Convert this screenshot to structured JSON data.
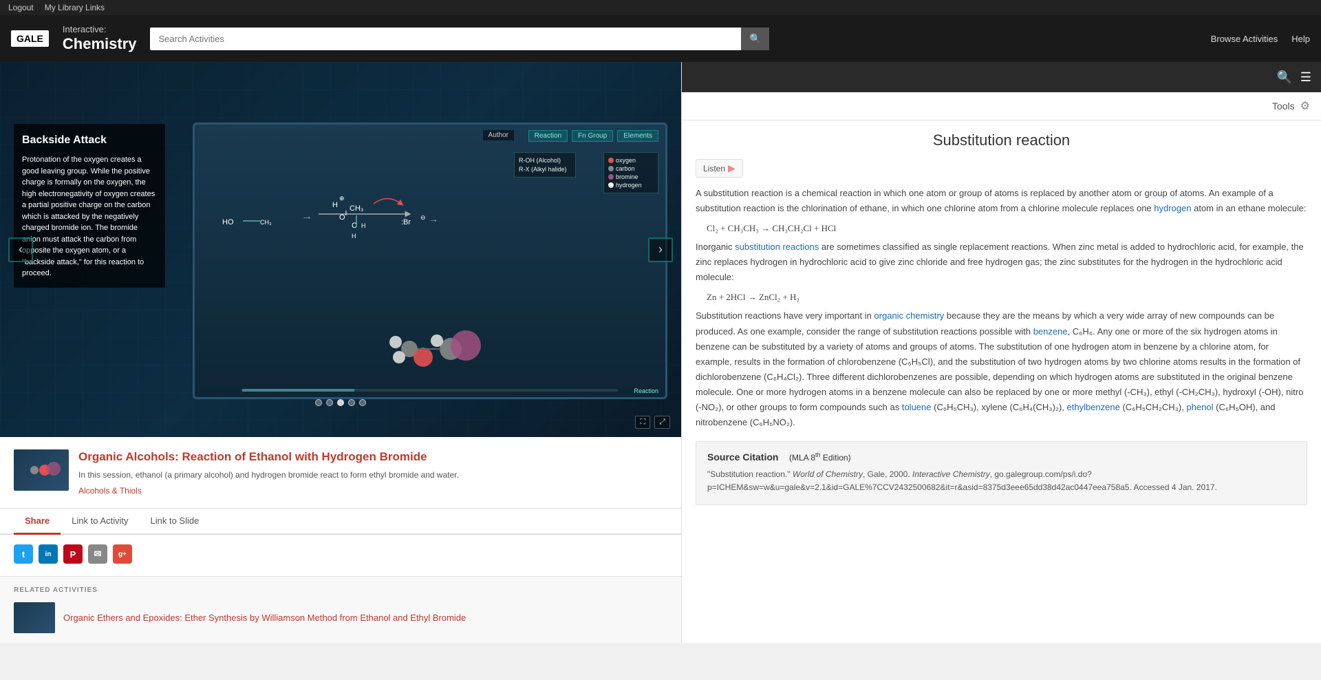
{
  "topnav": {
    "logout": "Logout",
    "library_links": "My Library Links"
  },
  "header": {
    "logo": "GALE",
    "subtitle": "Interactive:",
    "title": "Chemistry",
    "search_placeholder": "Search Activities",
    "browse": "Browse Activities",
    "help": "Help"
  },
  "viewer": {
    "title": "Backside Attack",
    "description": "Protonation of the oxygen creates a good leaving group. While the positive charge is formally on the oxygen, the high electronegativity of oxygen creates a partial positive charge on the carbon which is attacked by the negatively charged bromide ion. The bromide anion must attack the carbon from opposite the oxygen atom, or a \"backside attack,\" for this reaction to proceed.",
    "author_badge": "Author",
    "panels": [
      "Reaction",
      "Fn Group",
      "Elements"
    ],
    "legend": [
      {
        "label": "oxygen",
        "color": "#e05050"
      },
      {
        "label": "carbon",
        "color": "#888"
      },
      {
        "label": "bromine",
        "color": "#a05080"
      },
      {
        "label": "hydrogen",
        "color": "#eee"
      }
    ],
    "fn_group_labels": [
      "R-OH (Alcohol)",
      "R-X (Alkyl halide)"
    ],
    "reaction_label": "Reaction",
    "dots_count": 5,
    "active_dot": 2
  },
  "activity": {
    "title": "Organic Alcohols: Reaction of Ethanol with Hydrogen Bromide",
    "description": "In this session, ethanol (a primary alcohol) and hydrogen bromide react to form ethyl bromide and water.",
    "category": "Alcohols & Thiols"
  },
  "tabs": [
    {
      "label": "Share",
      "active": true
    },
    {
      "label": "Link to Activity",
      "active": false
    },
    {
      "label": "Link to Slide",
      "active": false
    }
  ],
  "social": [
    {
      "name": "Twitter",
      "class": "twitter",
      "symbol": "t"
    },
    {
      "name": "LinkedIn",
      "class": "linkedin",
      "symbol": "in"
    },
    {
      "name": "Pinterest",
      "class": "pinterest",
      "symbol": "P"
    },
    {
      "name": "Email",
      "class": "email",
      "symbol": "✉"
    },
    {
      "name": "Google",
      "class": "google",
      "symbol": "g+"
    }
  ],
  "related": {
    "label": "RELATED ACTIVITIES",
    "item_title": "Organic Ethers and Epoxides: Ether Synthesis by Williamson Method from Ethanol and Ethyl Bromide"
  },
  "article": {
    "title": "Substitution reaction",
    "listen_label": "Listen",
    "body_1": "A substitution reaction is a chemical reaction in which one atom or group of atoms is replaced by another atom or group of atoms. An example of a substitution reaction is the chlorination of ethane, in which one chlorine atom from a chlorine molecule replaces one hydrogen atom in an ethane molecule:",
    "eq1": "Cl₂ + CH₃CH₃ → CH₃CH₂Cl + HCl",
    "body_2": "Inorganic substitution reactions are sometimes classified as single replacement reactions. When zinc metal is added to hydrochloric acid, for example, the zinc replaces hydrogen in hydrochloric acid to give zinc chloride and free hydrogen gas; the zinc substitutes for the hydrogen in the hydrochloric acid molecule:",
    "eq2": "Zn + 2HCl → ZnCl₂ + H₂",
    "body_3": "Substitution reactions have very important in organic chemistry because they are the means by which a very wide array of new compounds can be produced. As one example, consider the range of substitution reactions possible with benzene, C₆H₆. Any one or more of the six hydrogen atoms in benzene can be substituted by a variety of atoms and groups of atoms. The substitution of one hydrogen atom in benzene by a chlorine atom, for example, results in the formation of chlorobenzene (C₆H₅Cl), and the substitution of two hydrogen atoms by two chlorine atoms results in the formation of dichlorobenzene (C₆H₄Cl₂). Three different dichlorobenzenes are possible, depending on which hydrogen atoms are substituted in the original benzene molecule. One or more hydrogen atoms in a benzene molecule can also be replaced by one or more methyl (-CH₃), ethyl (-CH₂CH₃), hydroxyl (-OH), nitro (-NO₂), or other groups to form compounds such as toluene (C₆H₅CH₃), xylene (C₆H₄(CH₃)₂), ethylbenzene (C₆H₅CH₂CH₃), phenol (C₆H₅OH), and nitrobenzene (C₆H₅NO₂).",
    "source_title": "Source Citation",
    "source_edition": "MLA 8",
    "source_edition_sup": "th",
    "source_edition_suffix": "Edition)",
    "source_body": "\"Substitution reaction.\" World of Chemistry, Gale, 2000. Interactive Chemistry, go.galegroup.com/ps/i.do?p=ICHEM&sw=w&u=gale&v=2.1&id=GALE%7CCV2432500682&it=r&asid=8375d3eee65dd38d42ac0447eea758a5. Accessed 4 Jan. 2017.",
    "tools_label": "Tools"
  }
}
